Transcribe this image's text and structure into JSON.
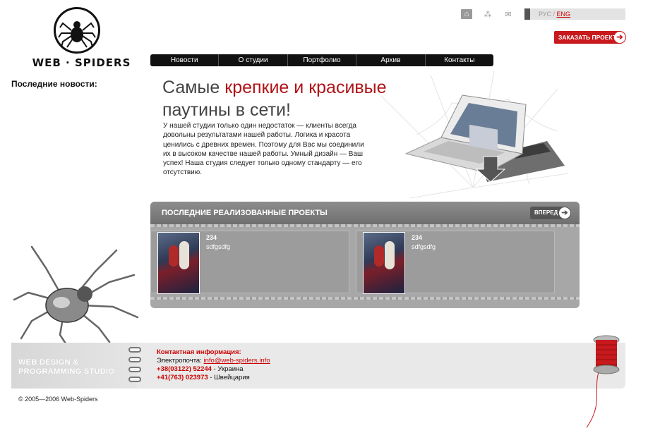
{
  "brand": {
    "wordmark": "WEB · SPIDERS"
  },
  "top_icons": [
    "home-icon",
    "sitemap-icon",
    "mail-icon"
  ],
  "language": {
    "rus": "РУС",
    "separator": " / ",
    "eng": "ENG"
  },
  "order_button": {
    "label": "ЗАКАЗАТЬ ПРОЕКТ"
  },
  "nav": {
    "items": [
      "Новости",
      "О студии",
      "Портфолио",
      "Архив",
      "Контакты"
    ]
  },
  "sidebar": {
    "news_heading": "Последние новости:"
  },
  "hero": {
    "line1_gray": "Самые ",
    "line1_red": "крепкие и красивые",
    "line2": "паутины в сети!",
    "intro": "У нашей студии только один недостаток — клиенты всегда довольны результатами нашей работы. Логика и красота ценились с древних времен. Поэтому для Вас мы соединили их в высоком качестве нашей работы. Умный дизайн — Ваш успех! Наша студия следует только одному стандарту — его отсутствию."
  },
  "projects": {
    "title": "ПОСЛЕДНИЕ РЕАЛИЗОВАННЫЕ ПРОЕКТЫ",
    "forward_label": "ВПЕРЕД",
    "items": [
      {
        "number": "234",
        "description": "sdfgsdfg"
      },
      {
        "number": "234",
        "description": "sdfgsdfg"
      }
    ]
  },
  "footer": {
    "studio_line1": "WEB DESIGN &",
    "studio_line2": "PROGRAMMING STUDIO",
    "contact_title": "Контактная информация:",
    "email_label": "Электропочта: ",
    "email": "info@web-spiders.info",
    "phone1": "+38(03122) 52244",
    "phone1_country": " - Украина",
    "phone2": "+41(763) 023973",
    "phone2_country": " - Швейцария"
  },
  "copyright": "© 2005—2006 Web-Spiders",
  "colors": {
    "accent_red": "#c8191c",
    "nav_bg": "#111111",
    "panel_gray": "#a7a7a7"
  }
}
